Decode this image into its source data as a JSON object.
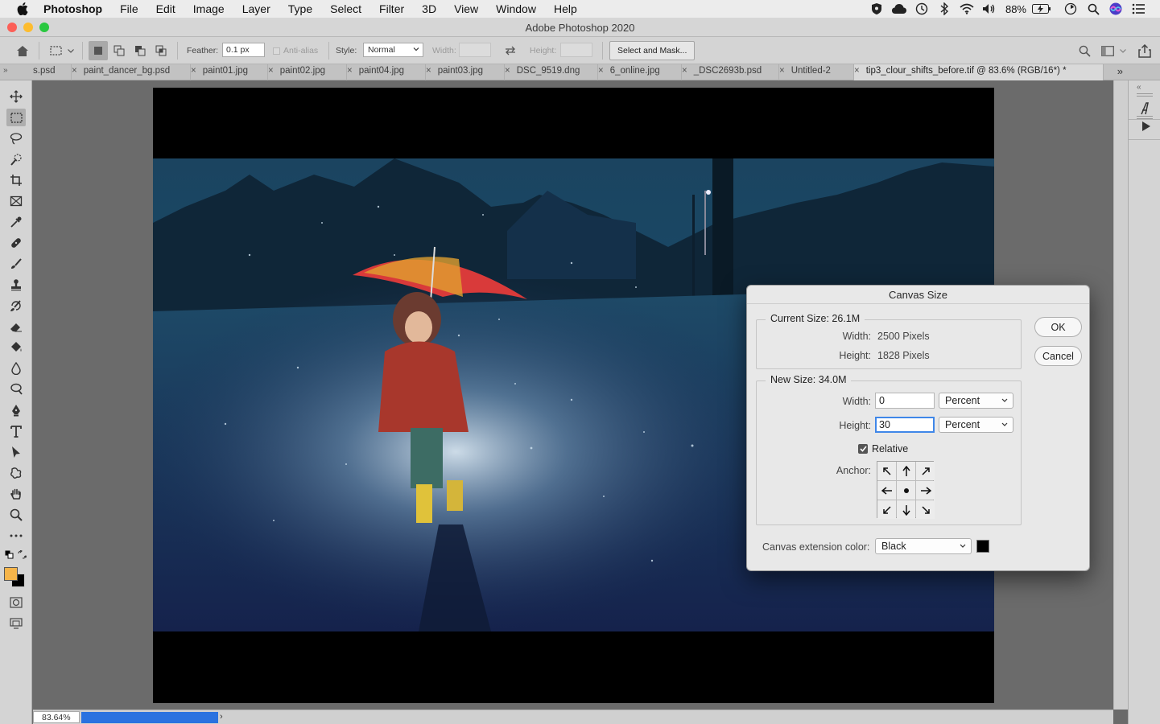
{
  "menubar": {
    "app_name": "Photoshop",
    "menus": [
      "File",
      "Edit",
      "Image",
      "Layer",
      "Type",
      "Select",
      "Filter",
      "3D",
      "View",
      "Window",
      "Help"
    ],
    "battery": "88%"
  },
  "window": {
    "title": "Adobe Photoshop 2020"
  },
  "options": {
    "feather_label": "Feather:",
    "feather_value": "0.1 px",
    "antialias_label": "Anti-alias",
    "style_label": "Style:",
    "style_value": "Normal",
    "width_label": "Width:",
    "height_label": "Height:",
    "select_mask_label": "Select and Mask..."
  },
  "tabs": [
    {
      "label": "s.psd"
    },
    {
      "label": "paint_dancer_bg.psd"
    },
    {
      "label": "paint01.jpg"
    },
    {
      "label": "paint02.jpg"
    },
    {
      "label": "paint04.jpg"
    },
    {
      "label": "paint03.jpg"
    },
    {
      "label": "DSC_9519.dng"
    },
    {
      "label": "6_online.jpg"
    },
    {
      "label": "_DSC2693b.psd"
    },
    {
      "label": "Untitled-2"
    },
    {
      "label": "tip3_clour_shifts_before.tif @ 83.6% (RGB/16*) *"
    }
  ],
  "status": {
    "zoom": "83.64%",
    "progress": 1.0
  },
  "dialog": {
    "title": "Canvas Size",
    "current_size_label": "Current Size: 26.1M",
    "current_width_label": "Width:",
    "current_width_value": "2500 Pixels",
    "current_height_label": "Height:",
    "current_height_value": "1828 Pixels",
    "new_size_label": "New Size: 34.0M",
    "new_width_label": "Width:",
    "new_width_value": "0",
    "new_width_unit": "Percent",
    "new_height_label": "Height:",
    "new_height_value": "30",
    "new_height_unit": "Percent",
    "relative_label": "Relative",
    "relative_checked": true,
    "anchor_label": "Anchor:",
    "extension_color_label": "Canvas extension color:",
    "extension_color_value": "Black",
    "ok_label": "OK",
    "cancel_label": "Cancel"
  },
  "colors": {
    "foreground": "#f6b54a",
    "background": "#000000",
    "accent": "#3f87e8"
  }
}
